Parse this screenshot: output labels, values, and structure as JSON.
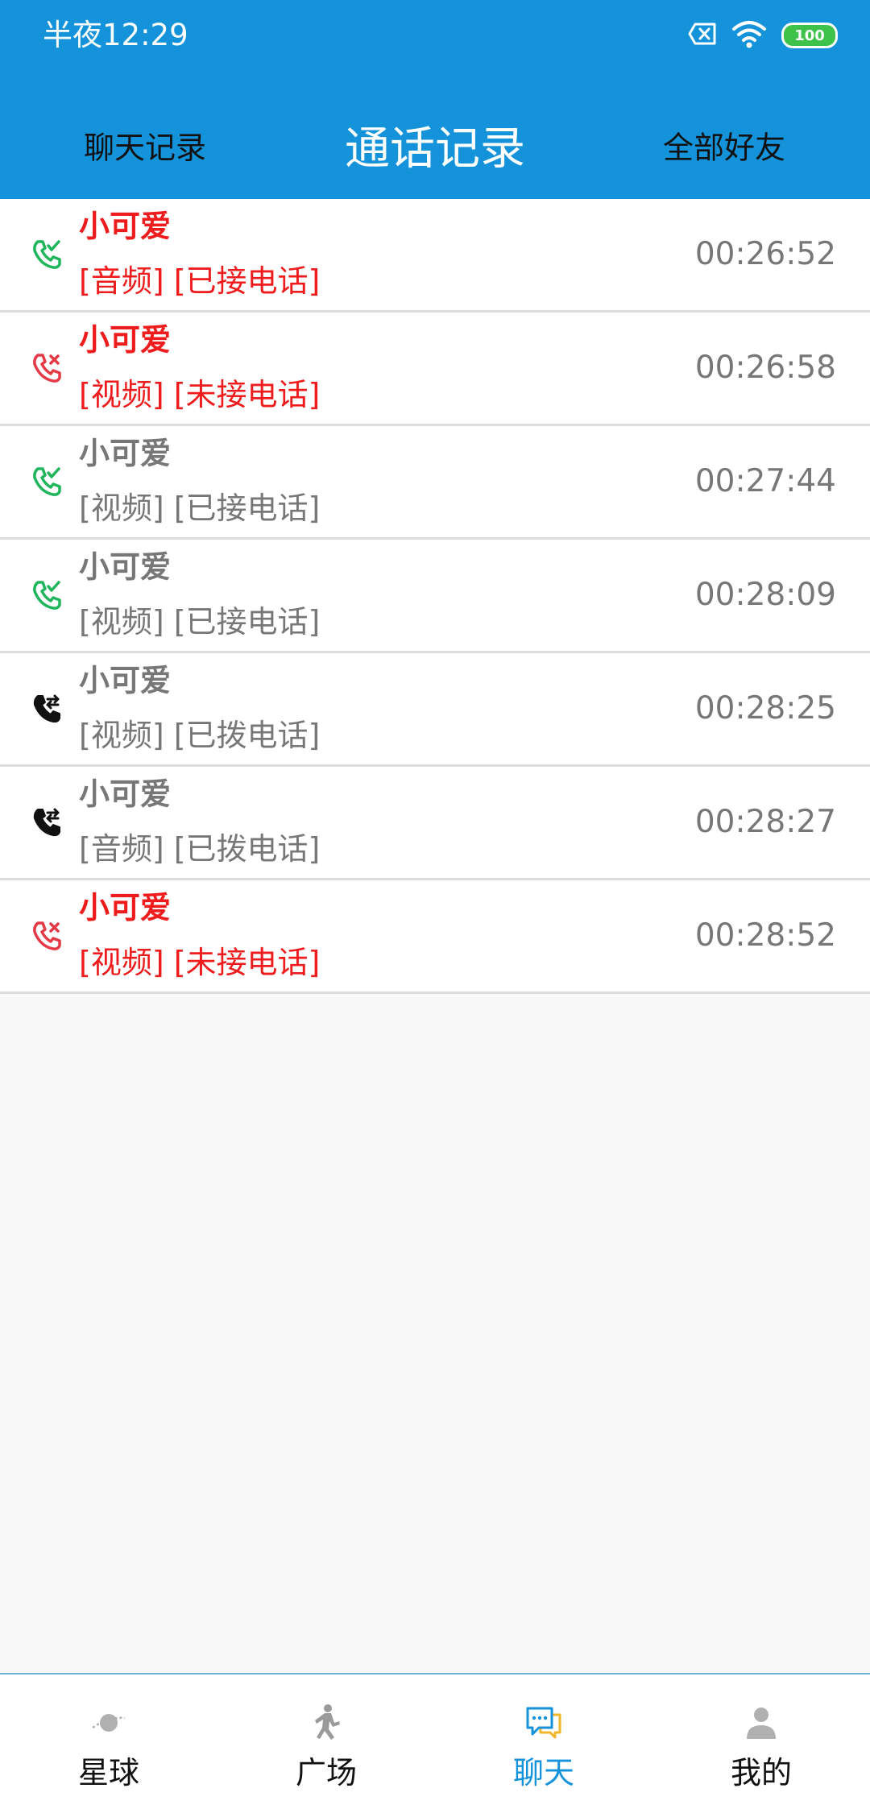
{
  "status_bar": {
    "time": "半夜12:29",
    "battery": "100",
    "icons": [
      "sim-no-icon",
      "wifi-icon",
      "battery-icon"
    ]
  },
  "header": {
    "left_tab": "聊天记录",
    "title": "通话记录",
    "right_tab": "全部好友",
    "background_color": "#1493db"
  },
  "calls": [
    {
      "name": "小可爱",
      "detail": "[音频] [已接电话]",
      "time": "00:26:52",
      "status": "answered",
      "icon": "call-answered-icon",
      "color": "#ee1c1c"
    },
    {
      "name": "小可爱",
      "detail": "[视频] [未接电话]",
      "time": "00:26:58",
      "status": "missed",
      "icon": "call-missed-icon",
      "color": "#ee1c1c"
    },
    {
      "name": "小可爱",
      "detail": "[视频] [已接电话]",
      "time": "00:27:44",
      "status": "answered",
      "icon": "call-answered-icon",
      "color": "#777777"
    },
    {
      "name": "小可爱",
      "detail": "[视频] [已接电话]",
      "time": "00:28:09",
      "status": "answered",
      "icon": "call-answered-icon",
      "color": "#777777"
    },
    {
      "name": "小可爱",
      "detail": "[视频] [已拨电话]",
      "time": "00:28:25",
      "status": "dialed",
      "icon": "call-outgoing-icon",
      "color": "#777777"
    },
    {
      "name": "小可爱",
      "detail": "[音频] [已拨电话]",
      "time": "00:28:27",
      "status": "dialed",
      "icon": "call-outgoing-icon",
      "color": "#777777"
    },
    {
      "name": "小可爱",
      "detail": "[视频] [未接电话]",
      "time": "00:28:52",
      "status": "missed",
      "icon": "call-missed-icon",
      "color": "#ee1c1c"
    }
  ],
  "bottom_nav": {
    "items": [
      {
        "label": "星球",
        "icon": "planet-icon",
        "active": false
      },
      {
        "label": "广场",
        "icon": "dancer-icon",
        "active": false
      },
      {
        "label": "聊天",
        "icon": "chat-icon",
        "active": true
      },
      {
        "label": "我的",
        "icon": "person-icon",
        "active": false
      }
    ],
    "active_color": "#1493db"
  }
}
